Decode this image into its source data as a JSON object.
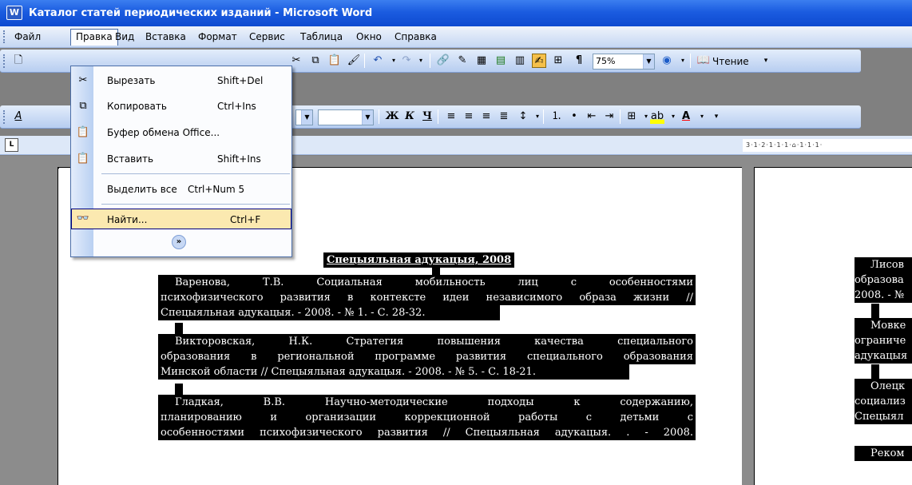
{
  "window": {
    "title": "Каталог статей периодических изданий - Microsoft Word",
    "app_icon": "word-icon"
  },
  "menubar": {
    "items": [
      "Файл",
      "Правка",
      "Вид",
      "Вставка",
      "Формат",
      "Сервис",
      "Таблица",
      "Окно",
      "Справка"
    ]
  },
  "toolbar": {
    "zoom": "75%",
    "reading_label": "Чтение"
  },
  "edit_menu": {
    "items": [
      {
        "label": "Вырезать",
        "shortcut": "Shift+Del",
        "icon": "scissors-icon"
      },
      {
        "label": "Копировать",
        "shortcut": "Ctrl+Ins",
        "icon": "copy-icon"
      },
      {
        "label": "Буфер обмена Office...",
        "shortcut": "",
        "icon": "clipboard-icon"
      },
      {
        "label": "Вставить",
        "shortcut": "Shift+Ins",
        "icon": "paste-icon"
      },
      {
        "label": "Выделить все",
        "shortcut": "Ctrl+Num 5",
        "icon": ""
      },
      {
        "label": "Найти...",
        "shortcut": "Ctrl+F",
        "icon": "binoculars-icon"
      }
    ]
  },
  "ruler": {
    "text": "3·1·2·1·1·1·⌂·1·1·1·"
  },
  "document": {
    "heading": "Спецыяльная адукацыя, 2008",
    "entries": [
      {
        "lines": [
          "Варенова,   Т.В.   Социальная   мобильность   лиц   с   особенностями",
          "психофизического развития в контексте идеи независимого образа жизни //",
          "Спецыяльная адукацыя. - 2008. - № 1. - С. 28-32."
        ]
      },
      {
        "lines": [
          "Викторовская,   Н.К.   Стратегия   повышения   качества   специального",
          "образования в региональной программе развития специального образования",
          "Минской области // Спецыяльная адукацыя. - 2008. - № 5. - С. 18-21."
        ]
      },
      {
        "lines": [
          "Гладкая,   В.В.   Научно-методические   подходы   к   содержанию,",
          "планированию   и   организации   коррекционной   работы   с   детьми   с",
          "особенностями психофизического развития // Спецыяльная адукацыя. . - 2008."
        ]
      }
    ],
    "right_page": {
      "lines": [
        "Лисов",
        "образова",
        "2008. - №",
        "Мовке",
        "ограниче",
        "адукацыя",
        "Олецк",
        "социализ",
        "Спецыял",
        "Реком"
      ]
    }
  }
}
